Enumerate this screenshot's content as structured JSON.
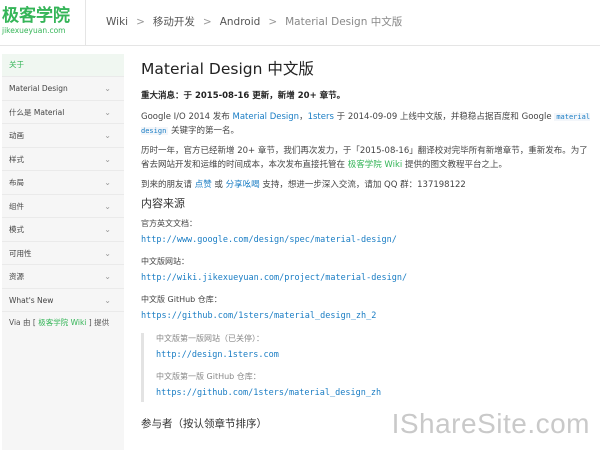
{
  "header": {
    "logo_cn": "极客学院",
    "logo_en": "jikexueyuan.com",
    "breadcrumb": [
      "Wiki",
      "移动开发",
      "Android",
      "Material Design 中文版"
    ]
  },
  "sidebar": {
    "items": [
      {
        "label": "关于",
        "active": true,
        "chevron": false
      },
      {
        "label": "Material Design",
        "chevron": true
      },
      {
        "label": "什么是 Material",
        "chevron": true
      },
      {
        "label": "动画",
        "chevron": true
      },
      {
        "label": "样式",
        "chevron": true
      },
      {
        "label": "布局",
        "chevron": true
      },
      {
        "label": "组件",
        "chevron": true
      },
      {
        "label": "模式",
        "chevron": true
      },
      {
        "label": "可用性",
        "chevron": true
      },
      {
        "label": "资源",
        "chevron": true
      },
      {
        "label": "What's New",
        "chevron": true
      }
    ],
    "footer": {
      "prefix": "Via 由 [ ",
      "link": "极客学院 Wiki",
      "suffix": " ] 提供"
    }
  },
  "main": {
    "title": "Material Design 中文版",
    "notice": "重大消息：于 2015-08-16 更新，新增 20+ 章节。",
    "p1": {
      "a": "Google I/O 2014 发布 ",
      "link1": "Material Design",
      "b": "，",
      "link2": "1sters",
      "c": " 于 2014-09-09 上线中文版，并稳稳占据百度和 Google ",
      "code": "material design",
      "d": " 关键字的第一名。"
    },
    "p2": {
      "a": "历时一年，官方已经新增 20+ 章节，我们再次发力，于「2015-08-16」翻译校对完毕所有新增章节，重新发布。为了省去网站开发和运维的时间成本，本次发布直接托管在 ",
      "link": "极客学院 Wiki",
      "b": " 提供的图文教程平台之上。"
    },
    "p3": {
      "a": "到来的朋友请 ",
      "link1": "点赞",
      "b": " 或 ",
      "link2": "分享吆喝",
      "c": " 支持，想进一步深入交流，请加 QQ 群：137198122"
    },
    "sources_heading": "内容来源",
    "sources": [
      {
        "label": "官方英文文档：",
        "url": "http://www.google.com/design/spec/material-design/"
      },
      {
        "label": "中文版网站：",
        "url": "http://wiki.jikexueyuan.com/project/material-design/"
      },
      {
        "label": "中文版 GitHub 仓库：",
        "url": "https://github.com/1sters/material_design_zh_2"
      }
    ],
    "old_sources": [
      {
        "label": "中文版第一版网站（已关停）：",
        "url": "http://design.1sters.com"
      },
      {
        "label": "中文版第一版 GitHub 仓库：",
        "url": "https://github.com/1sters/material_design_zh"
      }
    ],
    "contributors_heading": "参与者（按认领章节排序）"
  },
  "watermark": "IShareSite.com",
  "colors": {
    "brand_green": "#35b558",
    "link_blue": "#1a7dc4"
  }
}
